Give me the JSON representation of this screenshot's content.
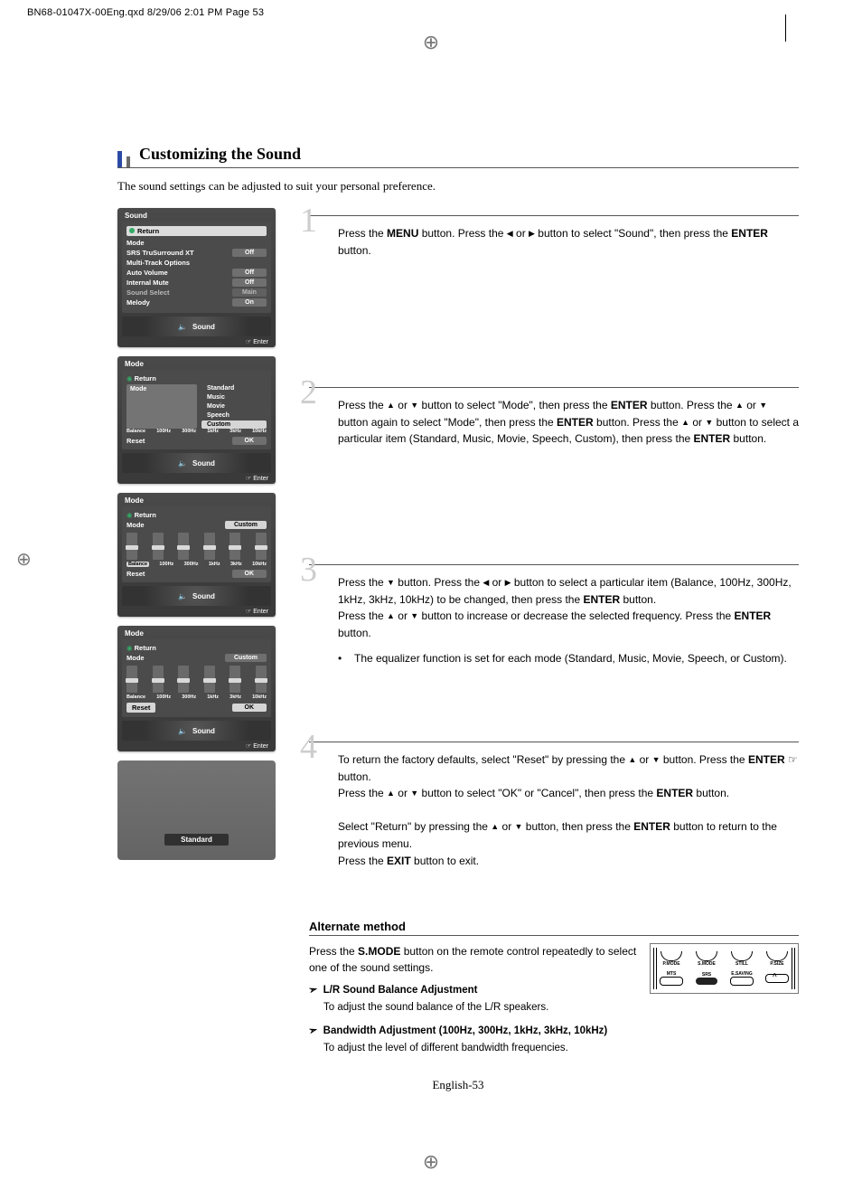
{
  "print_header": "BN68-01047X-00Eng.qxd  8/29/06  2:01 PM  Page 53",
  "section_title": "Customizing the Sound",
  "intro": "The sound settings can be adjusted to suit your personal preference.",
  "osd1": {
    "title": "Sound",
    "return": "Return",
    "rows": [
      {
        "lab": "Mode",
        "val": ""
      },
      {
        "lab": "SRS TruSurround XT",
        "val": "Off"
      },
      {
        "lab": "Multi-Track Options",
        "val": ""
      },
      {
        "lab": "Auto Volume",
        "val": "Off"
      },
      {
        "lab": "Internal Mute",
        "val": "Off"
      },
      {
        "lab": "Sound Select",
        "val": "Main"
      },
      {
        "lab": "Melody",
        "val": "On"
      }
    ],
    "footer": "Sound",
    "enter": "Enter"
  },
  "osd_mode": {
    "title": "Mode",
    "return": "Return",
    "mode_label": "Mode",
    "options": [
      "Standard",
      "Music",
      "Movie",
      "Speech",
      "Custom"
    ],
    "eq_labels": [
      "Balance",
      "100Hz",
      "300Hz",
      "1kHz",
      "3kHz",
      "10kHz"
    ],
    "reset": "Reset",
    "ok": "OK",
    "footer": "Sound",
    "enter": "Enter",
    "custom": "Custom"
  },
  "osd_plain_label": "Standard",
  "steps": {
    "s1": {
      "num": "1",
      "t1": "Press the ",
      "menu": "MENU",
      "t2": " button. Press the ",
      "t3": " or ",
      "t4": " button to select \"Sound\", then press the ",
      "enter": "ENTER",
      "t5": " button."
    },
    "s2": {
      "num": "2",
      "t1": "Press the ",
      "t2": " or ",
      "t3": " button to select \"Mode\", then press the ",
      "enter": "ENTER",
      "t4": " button. Press the ",
      "t5": " or ",
      "t6": " button again to select \"Mode\", then press the ",
      "t7": " button. Press the ",
      "t8": " or ",
      "t9": " button to select a particular item (Standard, Music, Movie, Speech, Custom), then press the ",
      "t10": " button."
    },
    "s3": {
      "num": "3",
      "t1": "Press the ",
      "t2": " button. Press the ",
      "t3": " or ",
      "t4": " button to select a particular item (Balance, 100Hz, 300Hz, 1kHz, 3kHz, 10kHz) to be changed, then press the ",
      "enter": "ENTER",
      "t5": " button.",
      "t6": "Press the ",
      "t7": " or ",
      "t8": " button to increase or decrease the selected frequency. Press the ",
      "t9": " button.",
      "bullet": "The equalizer function is set for each mode (Standard, Music, Movie, Speech, or Custom)."
    },
    "s4": {
      "num": "4",
      "t1": "To return the factory defaults, select \"Reset\" by pressing the ",
      "t2": " or ",
      "t3": " button. Press the ",
      "enter": "ENTER",
      "t4": " button.",
      "t5": "Press the ",
      "t6": " or ",
      "t7": " button to select \"OK\" or \"Cancel\", then press the ",
      "t8": " button.",
      "t9": "Select \"Return\" by pressing the ",
      "t10": " or ",
      "t11": " button, then press the ",
      "t12": " button to return to the previous menu.",
      "t13": "Press the ",
      "exit": "EXIT",
      "t14": " button to exit."
    }
  },
  "alternate": {
    "title": "Alternate method",
    "p1a": "Press the ",
    "smode": "S.MODE",
    "p1b": " button on the remote control repeatedly to select one of the sound settings.",
    "remote_labels_top": [
      "P.MODE",
      "S.MODE",
      "STILL",
      "P.SIZE"
    ],
    "remote_labels_bot": [
      "MTS",
      "SRS",
      "E.SAVING",
      ""
    ],
    "item1_hdr": "L/R Sound Balance Adjustment",
    "item1_txt": "To adjust the sound balance of the L/R speakers.",
    "item2_hdr": "Bandwidth Adjustment (100Hz, 300Hz, 1kHz, 3kHz, 10kHz)",
    "item2_txt": "To adjust the level of different bandwidth frequencies."
  },
  "page_num": "English-53"
}
